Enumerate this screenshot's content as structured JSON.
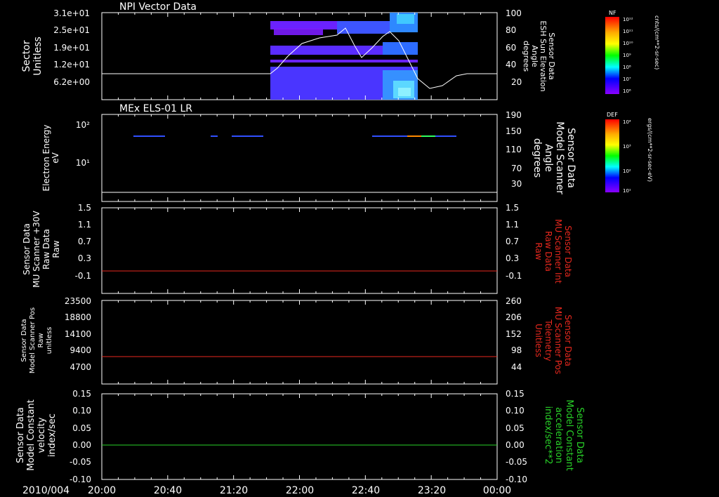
{
  "panels": [
    {
      "title": "NPI Vector Data",
      "left_label": [
        "Sector",
        "Unitless"
      ],
      "left_ticks": [
        "3.1e+01",
        "2.5e+01",
        "1.9e+01",
        "1.2e+01",
        "6.2e+00"
      ],
      "right_label": [
        "Sensor Data",
        "ESH Sun Elevation",
        "Angle",
        "degrees"
      ],
      "right_ticks": [
        "100",
        "80",
        "60",
        "40",
        "20"
      ],
      "colorbar": {
        "title": "NF",
        "ticks": [
          "10¹²",
          "10¹¹",
          "10¹⁰",
          "10⁹",
          "10⁸",
          "10⁷",
          "10⁶"
        ],
        "units": "cnts/(cm**2-sr-sec)"
      }
    },
    {
      "title": "MEx ELS-01 LR",
      "left_label": [
        "Electron Energy",
        "eV"
      ],
      "left_ticks": [
        "10²",
        "10¹"
      ],
      "right_label": [
        "Sensor Data",
        "Model Scanner",
        "Angle",
        "degrees"
      ],
      "right_ticks": [
        "190",
        "150",
        "110",
        "70",
        "30"
      ],
      "colorbar": {
        "title": "DEF",
        "ticks": [
          "10⁴",
          "10³",
          "10²",
          "10¹"
        ],
        "units": "ergs/(cm**2-sr-sec-eV)"
      }
    },
    {
      "left_label": [
        "Sensor Data",
        "MU Scanner +30V",
        "Raw Data",
        "Raw"
      ],
      "left_ticks": [
        "1.5",
        "1.1",
        "0.7",
        "0.3",
        "-0.1"
      ],
      "right_label": [
        "Sensor Data",
        "MU Scanner Int",
        "Raw Data",
        "Raw"
      ],
      "right_ticks": [
        "1.5",
        "1.1",
        "0.7",
        "0.3",
        "-0.1"
      ]
    },
    {
      "left_label": [
        "Sensor Data",
        "Model Scanner Pos",
        "Raw",
        "unitless"
      ],
      "left_ticks": [
        "23500",
        "18800",
        "14100",
        "9400",
        "4700"
      ],
      "right_label": [
        "Sensor Data",
        "MU Scanner Pos",
        "Telemetry",
        "Unitless"
      ],
      "right_ticks": [
        "260",
        "206",
        "152",
        "98",
        "44"
      ]
    },
    {
      "left_label": [
        "Sensor Data",
        "Model Constant",
        "velocity",
        "index/sec"
      ],
      "left_ticks": [
        "0.15",
        "0.10",
        "0.05",
        "0.00",
        "-0.05",
        "-0.10"
      ],
      "right_label": [
        "Sensor Data",
        "Model Constant",
        "acceleration",
        "index/sec**2"
      ],
      "right_ticks": [
        "0.15",
        "0.10",
        "0.05",
        "0.00",
        "-0.05",
        "-0.10"
      ]
    }
  ],
  "x_axis": {
    "date": "2010/004",
    "ticks": [
      "20:00",
      "20:40",
      "21:20",
      "22:00",
      "22:40",
      "23:20",
      "00:00"
    ]
  },
  "colors": {
    "red_trace": "#e8281e",
    "green_trace": "#28d228",
    "white_trace": "#ffffff"
  },
  "chart_data": [
    {
      "type": "heatmap",
      "title": "NPI Vector Data",
      "xlabel": "",
      "ylabel": "Sector Unitless",
      "x_range": [
        "20:00",
        "00:00"
      ],
      "overlay_line": {
        "name": "Sensor Data ESH Sun Elevation Angle degrees",
        "axis": "right",
        "ylim": [
          0,
          100
        ],
        "x": [
          "20:00",
          "21:45",
          "21:50",
          "22:00",
          "22:15",
          "22:25",
          "22:35",
          "22:45",
          "22:55",
          "23:05",
          "23:15",
          "23:25",
          "23:35",
          "23:40",
          "00:00"
        ],
        "y": [
          30,
          30,
          36,
          57,
          65,
          75,
          48,
          65,
          75,
          62,
          20,
          14,
          22,
          30,
          30
        ]
      }
    },
    {
      "type": "heatmap",
      "title": "MEx ELS-01 LR",
      "ylabel": "Electron Energy eV",
      "x_range": [
        "20:00",
        "00:00"
      ],
      "overlay_line": {
        "name": "Sensor Data Model Scanner Angle degrees",
        "axis": "right",
        "ylim": [
          0,
          190
        ],
        "x": [
          "20:00",
          "00:00"
        ],
        "y": [
          10,
          10
        ]
      }
    },
    {
      "type": "line",
      "series": [
        {
          "name": "Sensor Data MU Scanner Int Raw Data Raw",
          "x": [
            "20:00",
            "00:00"
          ],
          "y": [
            0,
            0
          ]
        }
      ],
      "ylim": [
        -0.3,
        1.5
      ]
    },
    {
      "type": "line",
      "series": [
        {
          "name": "Sensor Data MU Scanner Pos Telemetry Unitless",
          "x": [
            "20:00",
            "00:00"
          ],
          "y": [
            91,
            91
          ]
        }
      ],
      "ylim": [
        10,
        260
      ]
    },
    {
      "type": "line",
      "series": [
        {
          "name": "Sensor Data Model Constant acceleration index/sec**2",
          "x": [
            "20:00",
            "00:00"
          ],
          "y": [
            0,
            0
          ]
        }
      ],
      "ylim": [
        -0.1,
        0.15
      ]
    }
  ]
}
